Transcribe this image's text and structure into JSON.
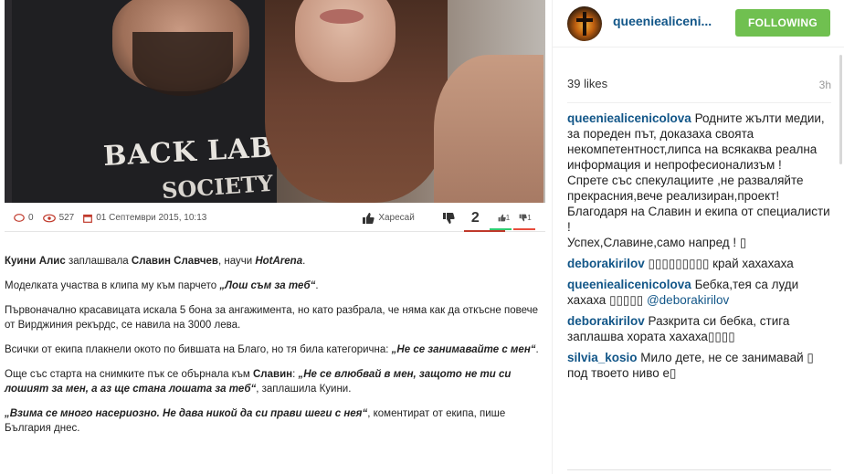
{
  "post": {
    "stats": {
      "comments_count": "0",
      "views_count": "527",
      "date": "01 Септември 2015, 10:13",
      "like_label": "Харесай",
      "vote_total": "2",
      "up_votes": "1",
      "down_votes": "1"
    },
    "photo_text": {
      "shirt_line1": "BACK LABEL",
      "shirt_line2": "SOCIETY"
    },
    "article": {
      "p1": [
        {
          "t": "Куини Алис",
          "s": "b"
        },
        {
          "t": " заплашвала ",
          "s": ""
        },
        {
          "t": "Славин Славчев",
          "s": "b"
        },
        {
          "t": ", научи ",
          "s": ""
        },
        {
          "t": "HotArena",
          "s": "bi"
        },
        {
          "t": ".",
          "s": ""
        }
      ],
      "p2": [
        {
          "t": "Моделката участва в клипа му към парчето ",
          "s": ""
        },
        {
          "t": "„Лош съм за теб“",
          "s": "bi"
        },
        {
          "t": ".",
          "s": ""
        }
      ],
      "p3": [
        {
          "t": "Първоначално красавицата искала 5 бона за ангажимента, но като разбрала, че няма как да откъсне повече от Вирджиния рекърдс, се навила на 3000 лева.",
          "s": ""
        }
      ],
      "p4": [
        {
          "t": "Всички от екипа плакнели окото по бившата на Благо, но тя била категорична: ",
          "s": ""
        },
        {
          "t": "„Не се занимавайте с мен“",
          "s": "bi"
        },
        {
          "t": ".",
          "s": ""
        }
      ],
      "p5": [
        {
          "t": "Още със старта на снимките пък се обърнала към ",
          "s": ""
        },
        {
          "t": "Славин",
          "s": "b"
        },
        {
          "t": ": ",
          "s": ""
        },
        {
          "t": "„Не се влюбвай в мен, защото не ти си лошият за мен, а аз ще стана лошата за теб“",
          "s": "bi"
        },
        {
          "t": ", заплашила Куини.",
          "s": ""
        }
      ],
      "p6": [
        {
          "t": "„Взима се много насериозно. Не дава никой да си прави шеги с нея“",
          "s": "bi"
        },
        {
          "t": ", коментират от екипа, пише България днес.",
          "s": ""
        }
      ]
    }
  },
  "instagram": {
    "username": "queeniealiceni...",
    "follow_label": "FOLLOWING",
    "likes": "39 likes",
    "time": "3h",
    "comments": [
      {
        "user": "queeniealicenicolova",
        "text": " Родните жълти медии, за пореден път, доказаха своята некомпетентност,липса на всякаква реална информация и непрофесионализъм !\nСпрете със спекулациите ,не разваляйте прекрасния,вече реализиран,проект!\nБлагодаря на Славин и екипа от специалисти !\nУспех,Славине,само напред ! ▯"
      },
      {
        "user": "deborakirilov",
        "text": " ▯▯▯▯▯▯▯▯▯ край хахахаха"
      },
      {
        "user": "queeniealicenicolova",
        "text": " Бебка,тея са луди хахаха ▯▯▯▯▯ ",
        "mention": "@deborakirilov"
      },
      {
        "user": "deborakirilov",
        "text": " Разкрита си бебка, стига заплашва хората хахаха▯▯▯▯"
      },
      {
        "user": "silvia_kosio",
        "text": " Мило дете, не се занимавай ▯ под твоето ниво е▯"
      }
    ],
    "colors": {
      "link": "#125688",
      "follow_bg": "#70c050"
    }
  }
}
